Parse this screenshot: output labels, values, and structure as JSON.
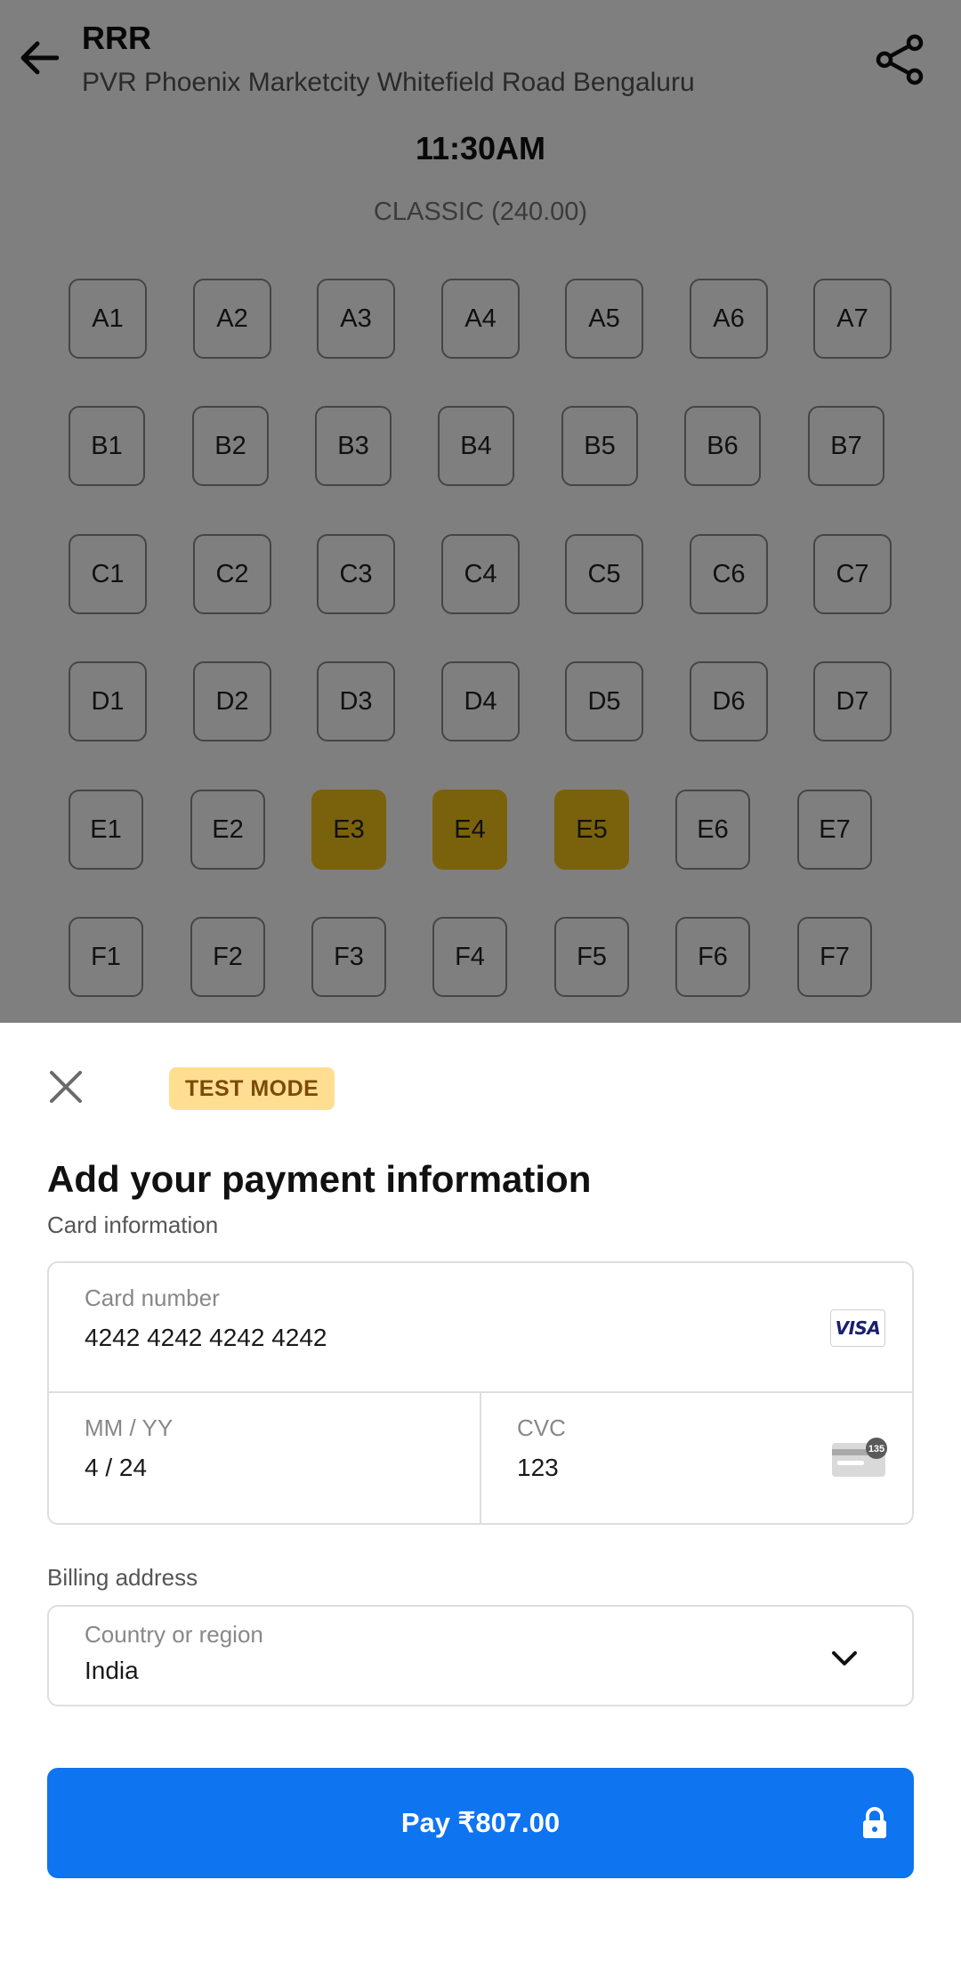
{
  "header": {
    "movie_title": "RRR",
    "cinema_name": "PVR Phoenix Marketcity Whitefield Road Bengaluru",
    "back_icon": "arrow-left-icon",
    "share_icon": "share-icon"
  },
  "showtime": "11:30AM",
  "seat_class": "CLASSIC (240.00)",
  "seat_rows": [
    [
      "A1",
      "A2",
      "A3",
      "A4",
      "A5",
      "A6",
      "A7"
    ],
    [
      "B1",
      "B2",
      "B3",
      "B4",
      "B5",
      "B6",
      "B7"
    ],
    [
      "C1",
      "C2",
      "C3",
      "C4",
      "C5",
      "C6",
      "C7"
    ],
    [
      "D1",
      "D2",
      "D3",
      "D4",
      "D5",
      "D6",
      "D7"
    ],
    [
      "E1",
      "E2",
      "E3",
      "E4",
      "E5",
      "E6",
      "E7"
    ],
    [
      "F1",
      "F2",
      "F3",
      "F4",
      "F5",
      "F6",
      "F7"
    ]
  ],
  "selected_seats": [
    "E3",
    "E4",
    "E5"
  ],
  "colors": {
    "selected_seat": "#f5c518",
    "pay_button": "#0f74f0",
    "test_badge_bg": "#ffde92",
    "test_badge_text": "#7c4a03"
  },
  "payment_sheet": {
    "close_icon": "close-icon",
    "test_mode_label": "TEST MODE",
    "title": "Add your payment information",
    "card_section_label": "Card information",
    "card_number": {
      "label": "Card number",
      "value": "4242 4242 4242 4242",
      "brand_icon": "visa-card-icon",
      "brand_text": "VISA"
    },
    "expiry": {
      "label": "MM / YY",
      "value": "4 / 24"
    },
    "cvc": {
      "label": "CVC",
      "value": "123",
      "icon": "cvc-card-icon",
      "icon_text": "135"
    },
    "billing_section_label": "Billing address",
    "country": {
      "label": "Country or region",
      "value": "India",
      "icon": "chevron-down-icon"
    },
    "pay_button_label": "Pay ₹807.00",
    "pay_button_icon": "lock-icon"
  }
}
